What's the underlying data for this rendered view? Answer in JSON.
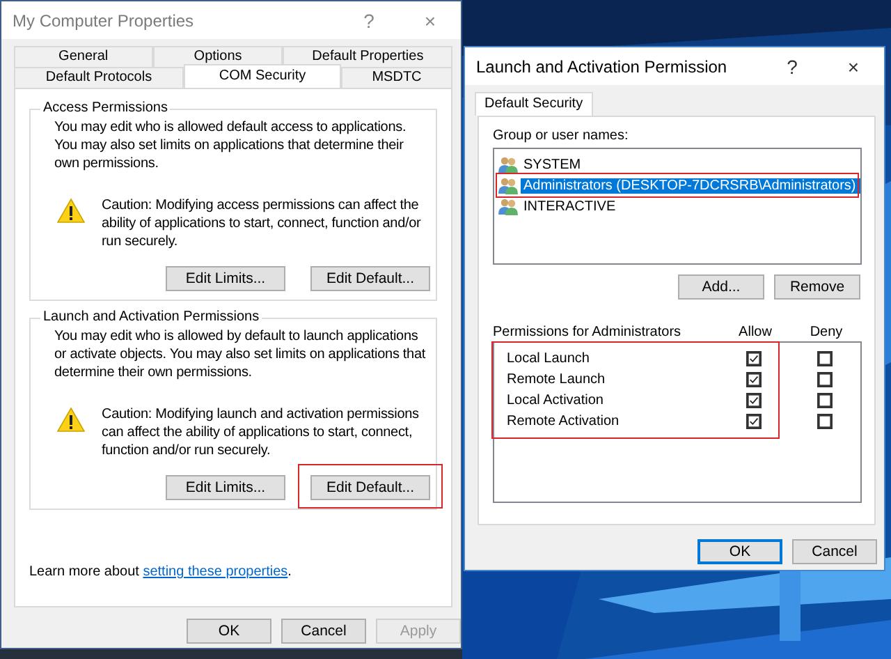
{
  "properties_dialog": {
    "title": "My Computer Properties",
    "title_buttons": [
      "?",
      "×"
    ],
    "tab_rows": [
      [
        {
          "label": "General",
          "selected": false
        },
        {
          "label": "Options",
          "selected": false
        },
        {
          "label": "Default Properties",
          "selected": false
        }
      ],
      [
        {
          "label": "Default Protocols",
          "selected": false
        },
        {
          "label": "COM Security",
          "selected": true
        },
        {
          "label": "MSDTC",
          "selected": false
        }
      ]
    ],
    "groups": [
      {
        "title": "Access Permissions",
        "description": "You may edit who is allowed default access to applications. You may also set limits on applications that determine their own permissions.",
        "caution": "Caution: Modifying access permissions can affect the ability of applications to start, connect, function and/or run securely.",
        "buttons": [
          {
            "label": "Edit Limits...",
            "highlighted": false
          },
          {
            "label": "Edit Default...",
            "highlighted": false
          }
        ]
      },
      {
        "title": "Launch and Activation Permissions",
        "description": "You may edit who is allowed by default to launch applications or activate objects. You may also set limits on applications that determine their own permissions.",
        "caution": "Caution: Modifying launch and activation permissions can affect the ability of applications to start, connect, function and/or run securely.",
        "buttons": [
          {
            "label": "Edit Limits...",
            "highlighted": false
          },
          {
            "label": "Edit Default...",
            "highlighted": true
          }
        ]
      }
    ],
    "learn_more": {
      "text": "Learn more about ",
      "link": "setting these properties",
      "after": "."
    },
    "buttons": [
      {
        "label": "OK",
        "disabled": false
      },
      {
        "label": "Cancel",
        "disabled": false
      },
      {
        "label": "Apply",
        "disabled": true
      }
    ]
  },
  "permission_dialog": {
    "title": "Launch and Activation Permission",
    "title_buttons": [
      "?",
      "×"
    ],
    "tabs": [
      {
        "label": "Default Security",
        "selected": true
      }
    ],
    "users_label": "Group or user names:",
    "users": [
      {
        "name": "SYSTEM",
        "selected": false,
        "highlighted": false
      },
      {
        "name": "Administrators (DESKTOP-7DCRSRB\\Administrators)",
        "selected": true,
        "highlighted": true
      },
      {
        "name": "INTERACTIVE",
        "selected": false,
        "highlighted": false
      }
    ],
    "user_buttons": [
      "Add...",
      "Remove"
    ],
    "permissions_label": "Permissions for Administrators",
    "columns": [
      "Allow",
      "Deny"
    ],
    "permissions_highlighted": true,
    "permissions": [
      {
        "name": "Local Launch",
        "allow": true,
        "deny": false
      },
      {
        "name": "Remote Launch",
        "allow": true,
        "deny": false
      },
      {
        "name": "Local Activation",
        "allow": true,
        "deny": false
      },
      {
        "name": "Remote Activation",
        "allow": true,
        "deny": false
      }
    ],
    "buttons": [
      {
        "label": "OK",
        "default": true
      },
      {
        "label": "Cancel",
        "default": false
      }
    ]
  }
}
